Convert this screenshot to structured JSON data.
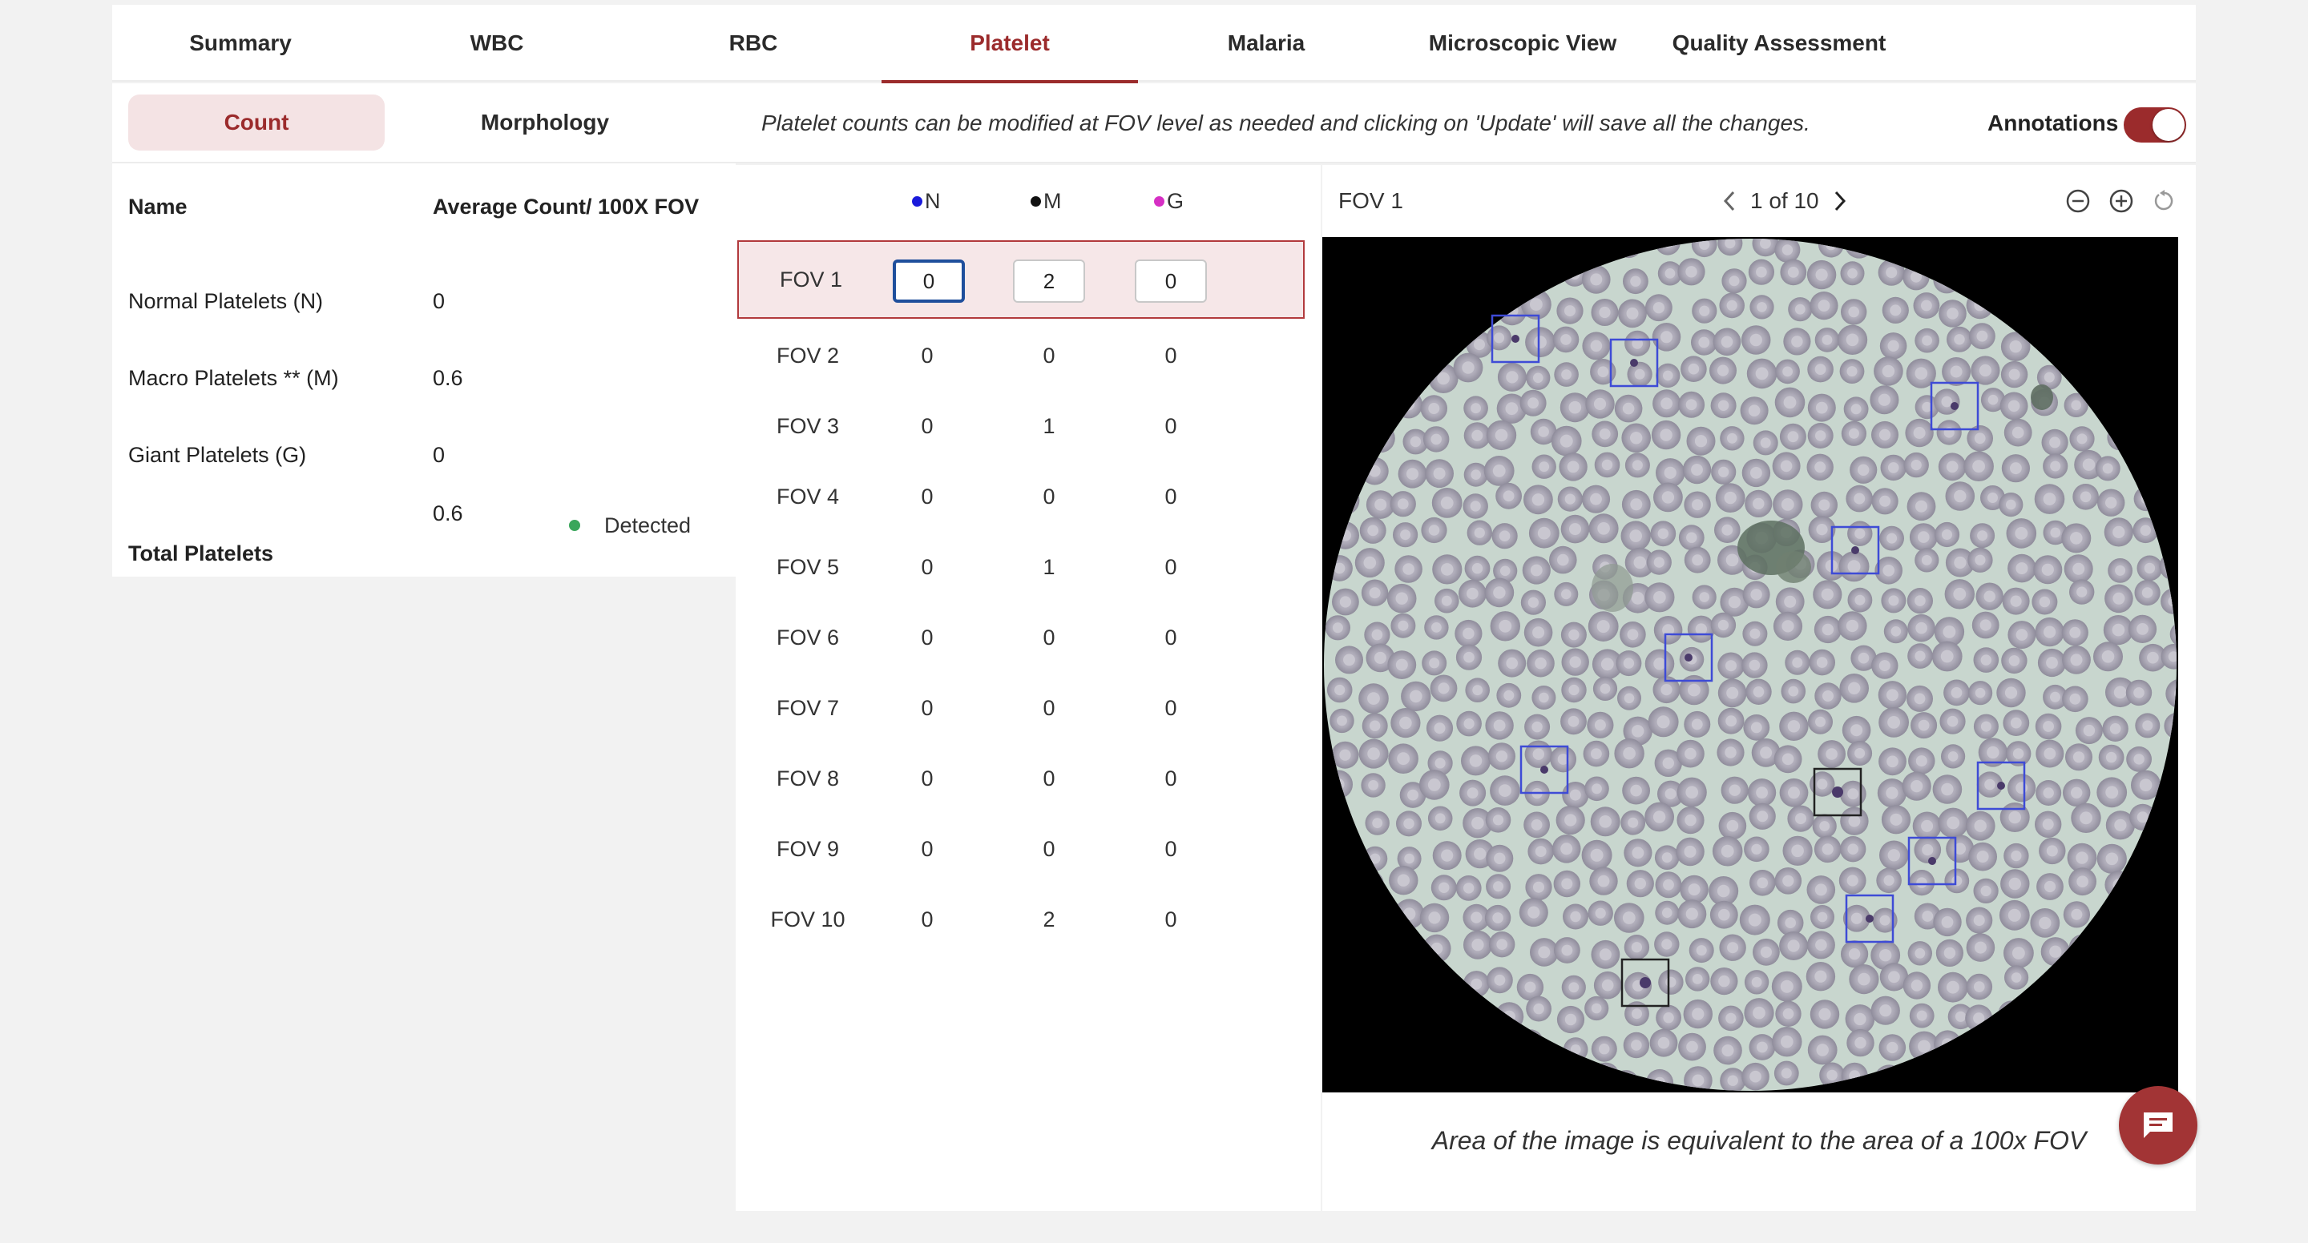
{
  "nav": {
    "tabs": [
      "Summary",
      "WBC",
      "RBC",
      "Platelet",
      "Malaria",
      "Microscopic View",
      "Quality Assessment"
    ],
    "active": "Platelet"
  },
  "subtabs": {
    "count": "Count",
    "morphology": "Morphology"
  },
  "summary": {
    "header_name": "Name",
    "header_value": "Average Count/ 100X FOV",
    "rows": [
      {
        "name": "Normal Platelets (N)",
        "value": "0"
      },
      {
        "name": "Macro Platelets ** (M)",
        "value": "0.6"
      },
      {
        "name": "Giant Platelets (G)",
        "value": "0"
      }
    ],
    "total_name": "Total Platelets",
    "total_value": "0.6",
    "status": "Detected"
  },
  "info": {
    "message": "Platelet counts can be modified at FOV level as needed and clicking on 'Update' will save all the changes.",
    "annotations_label": "Annotations",
    "annotations_on": true
  },
  "fov_table": {
    "columns": [
      {
        "label": "N",
        "color": "#1a1adb"
      },
      {
        "label": "M",
        "color": "#111111"
      },
      {
        "label": "G",
        "color": "#d62fc4"
      }
    ],
    "rows": [
      {
        "label": "FOV 1",
        "n": "0",
        "m": "2",
        "g": "0"
      },
      {
        "label": "FOV 2",
        "n": "0",
        "m": "0",
        "g": "0"
      },
      {
        "label": "FOV 3",
        "n": "0",
        "m": "1",
        "g": "0"
      },
      {
        "label": "FOV 4",
        "n": "0",
        "m": "0",
        "g": "0"
      },
      {
        "label": "FOV 5",
        "n": "0",
        "m": "1",
        "g": "0"
      },
      {
        "label": "FOV 6",
        "n": "0",
        "m": "0",
        "g": "0"
      },
      {
        "label": "FOV 7",
        "n": "0",
        "m": "0",
        "g": "0"
      },
      {
        "label": "FOV 8",
        "n": "0",
        "m": "0",
        "g": "0"
      },
      {
        "label": "FOV 9",
        "n": "0",
        "m": "0",
        "g": "0"
      },
      {
        "label": "FOV 10",
        "n": "0",
        "m": "2",
        "g": "0"
      }
    ]
  },
  "viewer": {
    "title": "FOV 1",
    "pager": "1 of 10",
    "caption": "Area of the image is equivalent to the area of a 100x FOV",
    "icons": [
      "chevron-left-icon",
      "chevron-right-icon",
      "zoom-out-icon",
      "zoom-in-icon",
      "reset-icon"
    ]
  },
  "colors": {
    "accent": "#9b2b2c",
    "normal_box": "#3e4bd6",
    "macro_box": "#222222",
    "smear_background": "#c9d6cf",
    "rbc": "#a9a7b3"
  }
}
